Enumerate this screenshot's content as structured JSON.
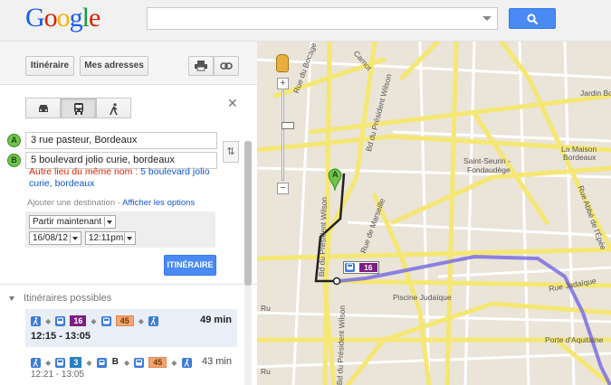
{
  "header": {
    "logo_letters": [
      "G",
      "o",
      "o",
      "g",
      "l",
      "e"
    ],
    "logo_colors": [
      "#1a5ee8",
      "#dd2200",
      "#f4b400",
      "#1a5ee8",
      "#109d3a",
      "#dd2200"
    ],
    "search_value": "",
    "search_icon": "search-icon"
  },
  "toolbar": {
    "itineraire_label": "Itinéraire",
    "mes_adresses_label": "Mes adresses",
    "print_icon": "print-icon",
    "link_icon": "link-icon"
  },
  "modes": [
    "car-icon",
    "transit-icon",
    "walk-icon"
  ],
  "directions": {
    "a_marker": "A",
    "b_marker": "B",
    "from": "3 rue pasteur, Bordeaux",
    "to": "5 boulevard jolio curie, bordeaux",
    "alt_prefix": "Autre lieu du même nom : ",
    "alt_link": "5 boulevard jolio curie, bordeaux",
    "add_destination": "Ajouter une destination",
    "add_sep": " - ",
    "show_options": "Afficher les options",
    "depart_mode": "Partir maintenant",
    "date": "16/08/12",
    "time": "12:11pm",
    "submit_label": "ITINÉRAIRE"
  },
  "routes_title": "Itinéraires possibles",
  "routes": [
    {
      "line1": "16",
      "line2": "45",
      "duration": "49 min",
      "times": "12:15 - 13:05"
    },
    {
      "line1": "3",
      "line_b": "B",
      "line2": "45",
      "duration": "43 min",
      "times": "12:21 - 13:05"
    }
  ],
  "map": {
    "labels": {
      "bocage": "Rue du Bocage",
      "carnot": "Carnot",
      "wilson_top": "Bd du Président Wilson",
      "wilson_mid": "Bd du Président Wilson",
      "wilson_bot": "Bd du Président Wilson",
      "jardin": "Jardin Bo",
      "maison": "La Maison",
      "maison2": "Bordeaux",
      "seurin": "Saint-Seurin -",
      "fondaudege": "Fondaudège",
      "marseille": "Rue de Marseille",
      "abbe": "Rue Abbé de l'Épée",
      "piscine": "Piscine Judaïque",
      "judaique": "Rue Judaïque",
      "porte": "Porte d'Aquitaine",
      "ru_left": "Ru",
      "ru_bottom": "Ru"
    },
    "start_marker": "A",
    "transit_line": "16"
  }
}
